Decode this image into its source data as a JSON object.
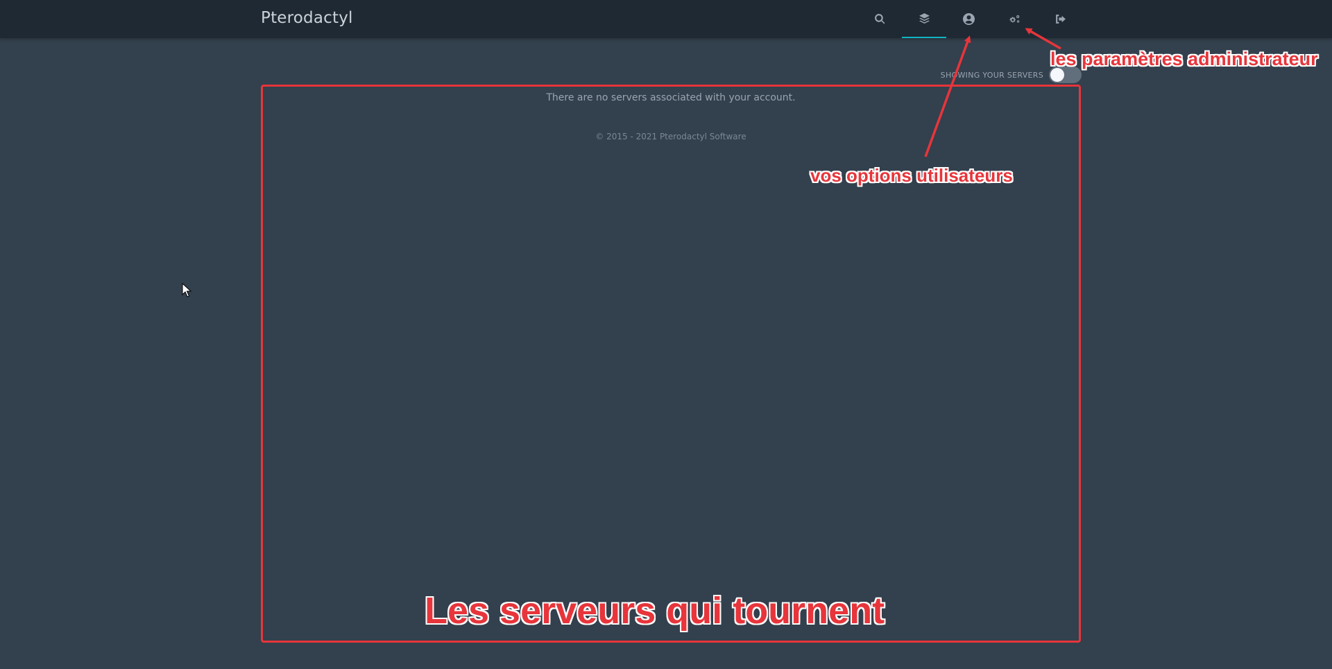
{
  "header": {
    "brand": "Pterodactyl",
    "nav": [
      {
        "name": "search-icon",
        "active": false
      },
      {
        "name": "servers-layers-icon",
        "active": true
      },
      {
        "name": "account-user-icon",
        "active": false
      },
      {
        "name": "admin-gears-icon",
        "active": false
      },
      {
        "name": "logout-icon",
        "active": false
      }
    ]
  },
  "toggle": {
    "label": "SHOWING YOUR SERVERS",
    "on": false
  },
  "main": {
    "empty_message": "There are no servers associated with your account.",
    "copyright": "© 2015 - 2021 Pterodactyl Software"
  },
  "annotations": {
    "admin": "les paramètres administrateur",
    "user": "vos options utilisateurs",
    "servers": "Les serveurs qui tournent",
    "color": "#e7353b"
  },
  "colors": {
    "background": "#33404d",
    "topbar": "#1f2933",
    "accent": "#0fb5c1"
  }
}
